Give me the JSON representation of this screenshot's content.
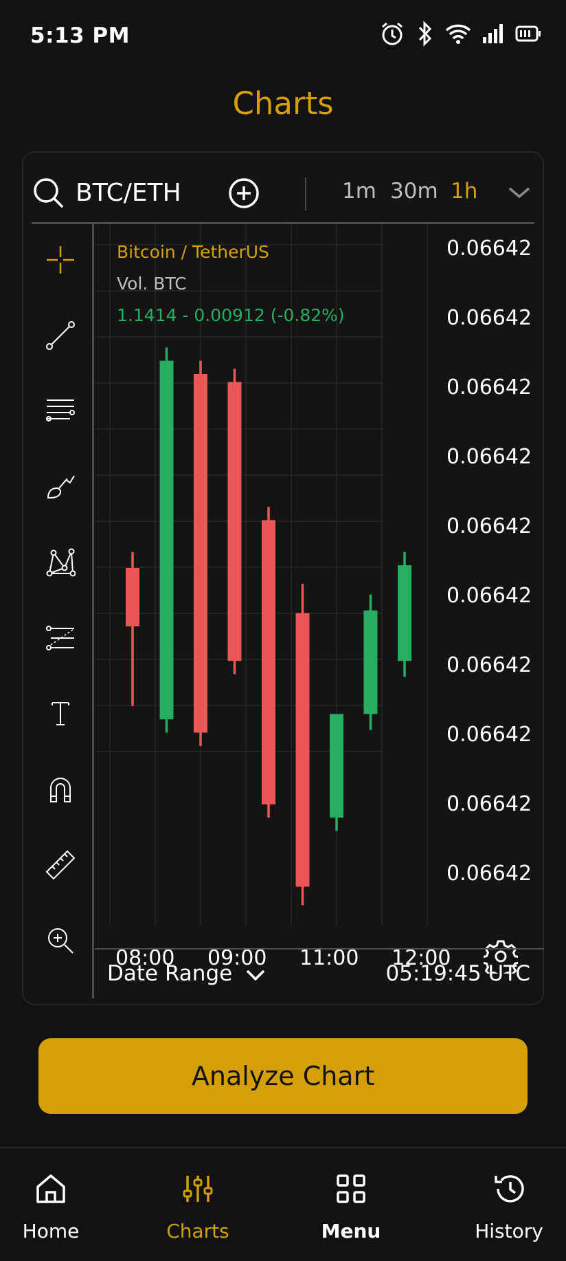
{
  "status_bar": {
    "time": "5:13 PM",
    "icons": [
      "alarm-icon",
      "bluetooth-icon",
      "wifi-icon",
      "signal-icon",
      "battery-icon"
    ]
  },
  "page": {
    "title": "Charts"
  },
  "toolbar": {
    "pair": "BTC/ETH",
    "timeframes": [
      {
        "label": "1m",
        "active": false
      },
      {
        "label": "30m",
        "active": false
      },
      {
        "label": "1h",
        "active": true
      }
    ]
  },
  "tools": [
    "crosshair-icon",
    "trend-line-icon",
    "horizontal-lines-icon",
    "brush-icon",
    "pattern-icon",
    "fib-lines-icon",
    "text-icon",
    "magnet-icon",
    "ruler-icon",
    "zoom-in-icon"
  ],
  "legend": {
    "pair_name": "Bitcoin / TetherUS",
    "volume": "Vol. BTC",
    "change": "1.1414 - 0.00912 (-0.82%)"
  },
  "price_axis": [
    "0.06642",
    "0.06642",
    "0.06642",
    "0.06642",
    "0.06642",
    "0.06642",
    "0.06642",
    "0.06642",
    "0.06642",
    "0.06642"
  ],
  "time_axis": [
    "08:00",
    "09:00",
    "11:00",
    "12:00"
  ],
  "footer": {
    "date_range_label": "Date Range",
    "utc_time": "05:19:45 UTC"
  },
  "analyze_button": "Analyze Chart",
  "nav": [
    {
      "label": "Home",
      "icon": "home-icon",
      "active": false
    },
    {
      "label": "Charts",
      "icon": "sliders-icon",
      "active": true
    },
    {
      "label": "Menu",
      "icon": "grid-icon",
      "active": false
    },
    {
      "label": "History",
      "icon": "history-icon",
      "active": false
    }
  ],
  "colors": {
    "accent": "#D5A007",
    "bull": "#27AE60",
    "bear": "#EB5757",
    "background": "#121212"
  },
  "chart_data": {
    "type": "candlestick",
    "categories": [
      "1",
      "2",
      "3",
      "4",
      "5",
      "6",
      "7",
      "8",
      "9"
    ],
    "series": [
      {
        "open": 0.0662,
        "high": 0.0668,
        "low": 0.061,
        "close": 0.064
      },
      {
        "open": 0.0605,
        "high": 0.0745,
        "low": 0.06,
        "close": 0.074
      },
      {
        "open": 0.0735,
        "high": 0.074,
        "low": 0.0595,
        "close": 0.06
      },
      {
        "open": 0.0732,
        "high": 0.0737,
        "low": 0.0622,
        "close": 0.0627
      },
      {
        "open": 0.068,
        "high": 0.0685,
        "low": 0.0568,
        "close": 0.0573
      },
      {
        "open": 0.0645,
        "high": 0.0656,
        "low": 0.0535,
        "close": 0.0542
      },
      {
        "open": 0.0568,
        "high": 0.0602,
        "low": 0.0563,
        "close": 0.0607
      },
      {
        "open": 0.0607,
        "high": 0.0652,
        "low": 0.0601,
        "close": 0.0646
      },
      {
        "open": 0.0627,
        "high": 0.0668,
        "low": 0.0621,
        "close": 0.0663
      }
    ],
    "ylim": [
      0.053,
      0.075
    ],
    "grid": true,
    "legend": "top-left"
  }
}
